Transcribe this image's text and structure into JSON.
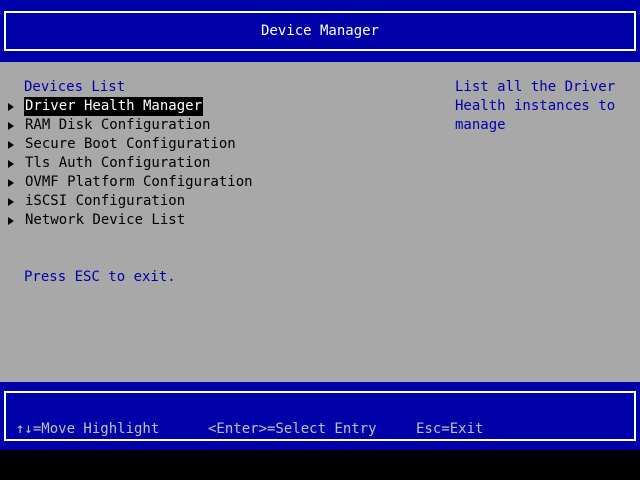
{
  "header": {
    "title": "Device Manager"
  },
  "main": {
    "section_title": "Devices List",
    "items": [
      {
        "label": "Driver Health Manager",
        "selected": true
      },
      {
        "label": "RAM Disk Configuration",
        "selected": false
      },
      {
        "label": "Secure Boot Configuration",
        "selected": false
      },
      {
        "label": "Tls Auth Configuration",
        "selected": false
      },
      {
        "label": "OVMF Platform Configuration",
        "selected": false
      },
      {
        "label": "iSCSI Configuration",
        "selected": false
      },
      {
        "label": "Network Device List",
        "selected": false
      }
    ],
    "help_text": "List all the Driver\nHealth instances to\nmanage",
    "esc_text": "Press ESC to exit."
  },
  "footer": {
    "move_hint": "↑↓=Move Highlight",
    "select_hint": "<Enter>=Select Entry",
    "exit_hint": "Esc=Exit"
  },
  "colors": {
    "band_blue": "#0000a8",
    "panel_gray": "#a8a8a8",
    "highlight_bg": "#000000",
    "highlight_fg": "#ffffff",
    "info_text": "#0000a8"
  }
}
